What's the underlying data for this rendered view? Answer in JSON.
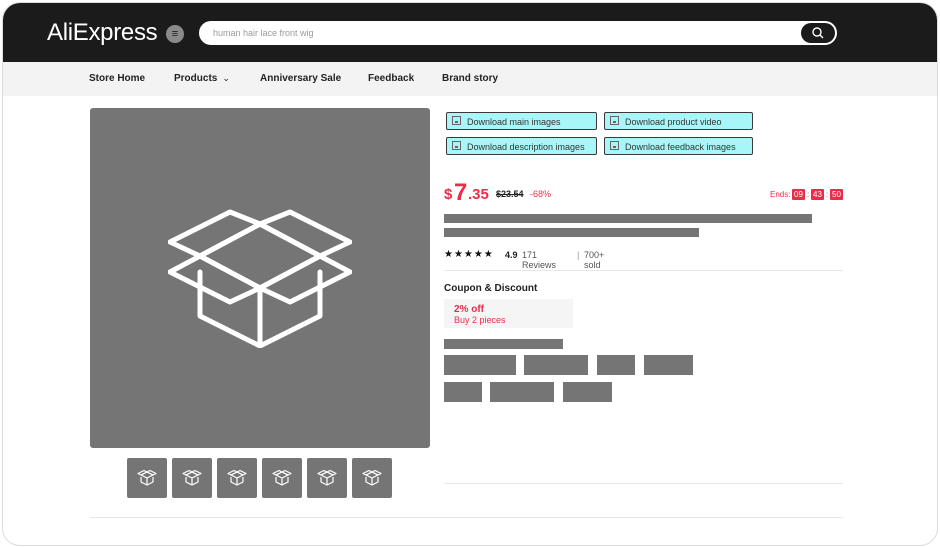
{
  "header": {
    "logo": "AliExpress",
    "search_placeholder": "human hair lace front wig"
  },
  "nav": {
    "items": [
      {
        "label": "Store Home"
      },
      {
        "label": "Products",
        "has_dropdown": true
      },
      {
        "label": "Anniversary Sale"
      },
      {
        "label": "Feedback"
      },
      {
        "label": "Brand story"
      }
    ]
  },
  "download_buttons": [
    {
      "label": "Download main images"
    },
    {
      "label": "Download product video"
    },
    {
      "label": "Download description images"
    },
    {
      "label": "Download feedback images"
    }
  ],
  "price": {
    "currency": "$",
    "integer": "7",
    "cents": ".35",
    "original": "$23.54",
    "discount": "-68%"
  },
  "countdown": {
    "label": "Ends:",
    "hours": "09",
    "minutes": "43",
    "seconds": "50",
    "separator": ":"
  },
  "rating": {
    "stars": "★★★★★",
    "value": "4.9",
    "reviews": "171 Reviews",
    "separator": "|",
    "sold": "700+ sold"
  },
  "coupon": {
    "title": "Coupon & Discount",
    "percent": "2% off",
    "condition": "Buy 2 pieces"
  },
  "icons": {
    "main_image": "open-box-icon",
    "thumbnail": "open-box-icon",
    "search": "search-icon",
    "menu": "menu-icon",
    "download": "image-file-icon"
  },
  "colors": {
    "header_bg": "#1b1b1b",
    "accent_red": "#e92e4a",
    "download_bg": "#a7f6f8",
    "placeholder_gray": "#757575",
    "nav_bg": "#f3f3f3"
  }
}
